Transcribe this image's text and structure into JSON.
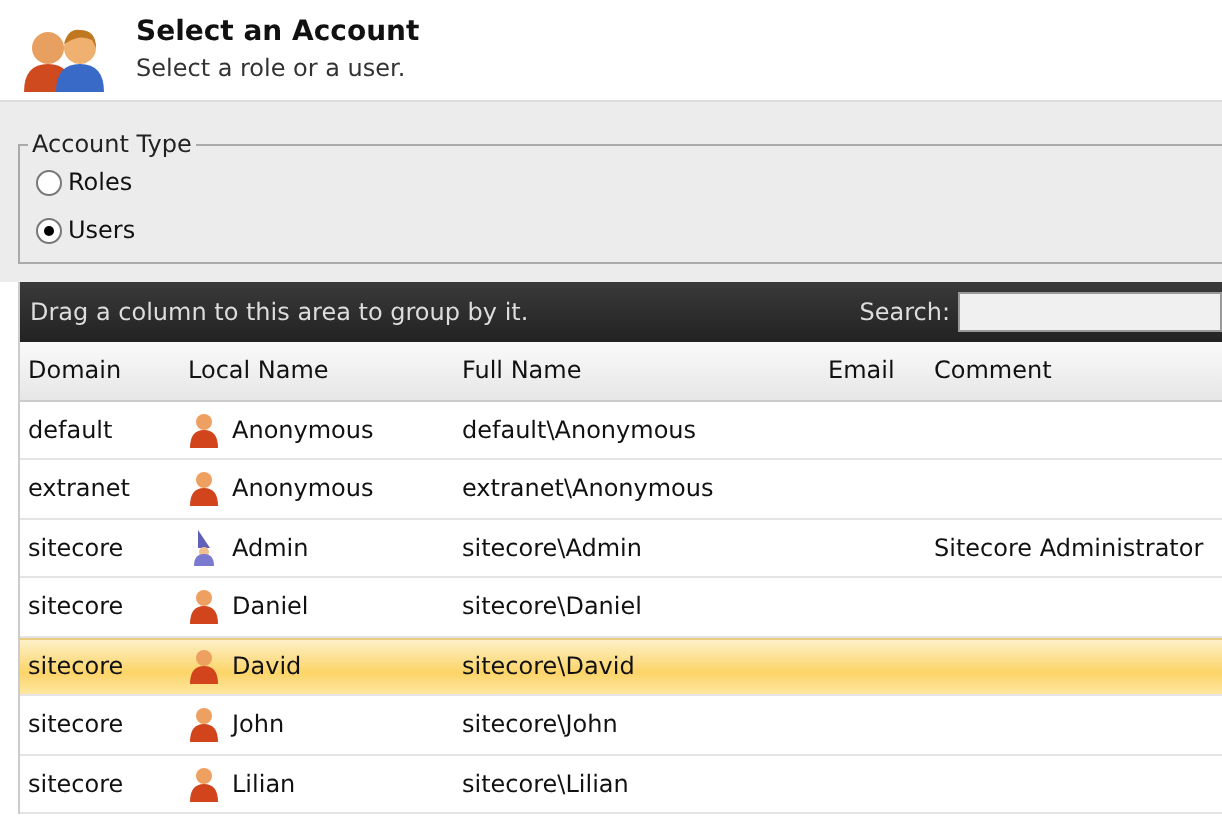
{
  "header": {
    "title": "Select an Account",
    "subtitle": "Select a role or a user."
  },
  "account_type": {
    "legend": "Account Type",
    "options": [
      {
        "label": "Roles",
        "selected": false
      },
      {
        "label": "Users",
        "selected": true
      }
    ]
  },
  "grid": {
    "group_hint": "Drag a column to this area to group by it.",
    "search_label": "Search:",
    "columns": [
      "Domain",
      "Local Name",
      "Full Name",
      "Email",
      "Comment"
    ],
    "rows": [
      {
        "domain": "default",
        "kind": "user",
        "local_name": "Anonymous",
        "full_name": "default\\Anonymous",
        "comment": "",
        "selected": false
      },
      {
        "domain": "extranet",
        "kind": "user",
        "local_name": "Anonymous",
        "full_name": "extranet\\Anonymous",
        "comment": "",
        "selected": false
      },
      {
        "domain": "sitecore",
        "kind": "admin",
        "local_name": "Admin",
        "full_name": "sitecore\\Admin",
        "comment": "Sitecore Administrator",
        "selected": false
      },
      {
        "domain": "sitecore",
        "kind": "user",
        "local_name": "Daniel",
        "full_name": "sitecore\\Daniel",
        "comment": "",
        "selected": false
      },
      {
        "domain": "sitecore",
        "kind": "user",
        "local_name": "David",
        "full_name": "sitecore\\David",
        "comment": "",
        "selected": true
      },
      {
        "domain": "sitecore",
        "kind": "user",
        "local_name": "John",
        "full_name": "sitecore\\John",
        "comment": "",
        "selected": false
      },
      {
        "domain": "sitecore",
        "kind": "user",
        "local_name": "Lilian",
        "full_name": "sitecore\\Lilian",
        "comment": "",
        "selected": false
      }
    ]
  }
}
